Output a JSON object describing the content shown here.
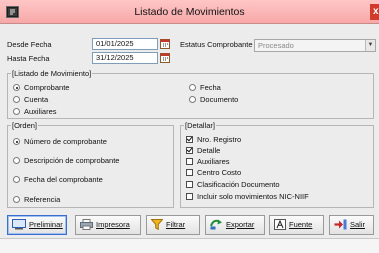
{
  "window": {
    "title": "Listado de Movimientos"
  },
  "filters": {
    "desde_label": "Desde Fecha",
    "desde_value": "01/01/2025",
    "hasta_label": "Hasta Fecha",
    "hasta_value": "31/12/2025",
    "estatus_label": "Estatus Comprobante",
    "estatus_value": "Procesado"
  },
  "listado": {
    "title": "[Listado de Movimiento]",
    "options": [
      "Comprobante",
      "Fecha",
      "Cuenta",
      "Documento",
      "Auxiliares"
    ],
    "selected": "Comprobante"
  },
  "orden": {
    "title": "[Orden]",
    "options": [
      "Número de comprobante",
      "Descripción de comprobante",
      "Fecha del comprobante",
      "Referencia"
    ],
    "selected": "Número de comprobante"
  },
  "detallar": {
    "title": "[Detallar]",
    "items": [
      {
        "label": "Nro. Registro",
        "checked": true
      },
      {
        "label": "Detalle",
        "checked": true
      },
      {
        "label": "Auxiliares",
        "checked": false
      },
      {
        "label": "Centro Costo",
        "checked": false
      },
      {
        "label": "Clasificación Documento",
        "checked": false
      },
      {
        "label": "Incluir solo movimientos NIC-NIIF",
        "checked": false
      }
    ]
  },
  "toolbar": {
    "preliminar": "Preliminar",
    "impresora": "Impresora",
    "filtrar": "Filtrar",
    "exportar": "Exportar",
    "fuente": "Fuente",
    "salir": "Salir"
  },
  "icons": {
    "preliminar": "preview-icon",
    "impresora": "printer-icon",
    "filtrar": "funnel-icon",
    "exportar": "export-icon",
    "fuente": "font-icon",
    "salir": "exit-icon"
  },
  "colors": {
    "titlebar": "#f7a8a8",
    "close": "#d23b2b",
    "field_border": "#7f9db9"
  }
}
